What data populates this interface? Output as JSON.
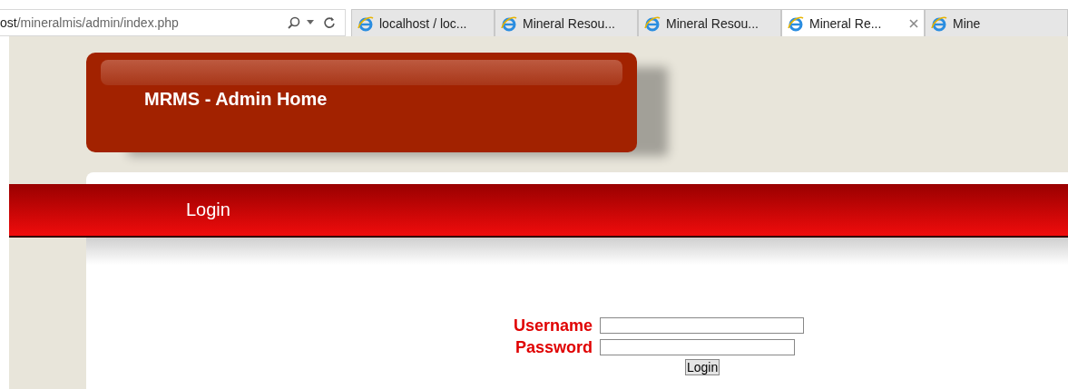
{
  "address_bar": {
    "host_fragment": "ost",
    "path": "/mineralmis/admin/index.php"
  },
  "tabs": [
    {
      "label": "localhost / loc...",
      "selected": false
    },
    {
      "label": "Mineral Resou...",
      "selected": false
    },
    {
      "label": "Mineral Resou...",
      "selected": false
    },
    {
      "label": "Mineral Re...",
      "selected": true
    },
    {
      "label": "Mine",
      "selected": false
    }
  ],
  "header": {
    "title": "MRMS - Admin Home"
  },
  "nav": {
    "label": "Login"
  },
  "form": {
    "fields": [
      {
        "label": "Username"
      },
      {
        "label": "Password"
      }
    ],
    "button": "Login"
  }
}
